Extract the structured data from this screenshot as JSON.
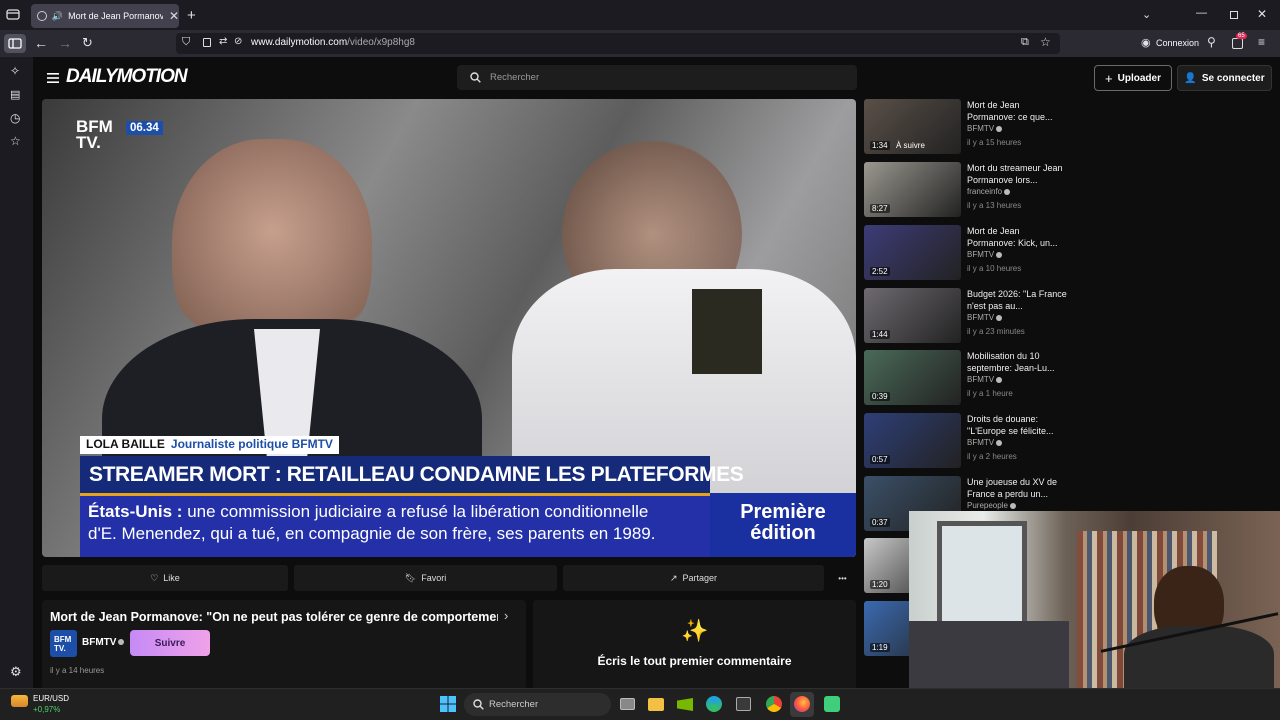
{
  "browser": {
    "tab_title": "Mort de Jean Pormanove: \"",
    "url_host": "www.dailymotion.com",
    "url_path": "/video/x9p8hg8",
    "account_label": "Connexion",
    "extension_badge": "65"
  },
  "site": {
    "logo": "DAILYMOTION",
    "search_placeholder": "Rechercher",
    "upload_label": "Uploader",
    "login_label": "Se connecter"
  },
  "video": {
    "channel_logo_top": "BFM",
    "channel_logo_bottom": "TV.",
    "clock": "06.34",
    "speaker_name": "LOLA BAILLE",
    "speaker_role": "Journaliste politique BFMTV",
    "headline": "STREAMER MORT : RETAILLEAU CONDAMNE LES PLATEFORMES",
    "ticker_label": "États-Unis :",
    "ticker_line1": "une commission judiciaire a refusé la libération conditionnelle",
    "ticker_line2": "d'E. Menendez, qui a tué, en compagnie de son frère, ses parents en 1989.",
    "show_line1": "Première",
    "show_line2": "édition"
  },
  "actions": {
    "like": "Like",
    "favorite": "Favori",
    "share": "Partager",
    "more": "•••"
  },
  "info": {
    "title": "Mort de Jean Pormanove: \"On ne peut pas tolérer ce genre de comportement...",
    "channel": "BFMTV",
    "channel_logo_top": "BFM",
    "channel_logo_bottom": "TV.",
    "follow_label": "Suivre",
    "published": "il y a 14 heures"
  },
  "comments": {
    "empty_label": "Écris le tout premier commentaire"
  },
  "recommendations": [
    {
      "title": "Mort de Jean Pormanove: ce que...",
      "channel": "BFMTV",
      "verified": true,
      "time": "il y a 15 heures",
      "duration": "1:34",
      "badge": "À suivre",
      "color": "#5a5048"
    },
    {
      "title": "Mort du streameur Jean Pormanove lors...",
      "channel": "franceinfo",
      "verified": true,
      "time": "il y a 13 heures",
      "duration": "8:27",
      "badge": "",
      "color": "#9a9890"
    },
    {
      "title": "Mort de Jean Pormanove: Kick, un...",
      "channel": "BFMTV",
      "verified": true,
      "time": "il y a 10 heures",
      "duration": "2:52",
      "badge": "",
      "color": "#3d3c78"
    },
    {
      "title": "Budget 2026: \"La France n'est pas au...",
      "channel": "BFMTV",
      "verified": true,
      "time": "il y a 23 minutes",
      "duration": "1:44",
      "badge": "",
      "color": "#6e6a70"
    },
    {
      "title": "Mobilisation du 10 septembre: Jean-Lu...",
      "channel": "BFMTV",
      "verified": true,
      "time": "il y a 1 heure",
      "duration": "0:39",
      "badge": "",
      "color": "#4a6a58"
    },
    {
      "title": "Droits de douane: \"L'Europe se félicite...",
      "channel": "BFMTV",
      "verified": true,
      "time": "il y a 2 heures",
      "duration": "0:57",
      "badge": "",
      "color": "#2e3f78"
    },
    {
      "title": "Une joueuse du XV de France a perdu un...",
      "channel": "Purepeople",
      "verified": true,
      "time": "",
      "duration": "0:37",
      "badge": "",
      "color": "#3a5068"
    },
    {
      "title": "",
      "channel": "",
      "verified": false,
      "time": "",
      "duration": "1:20",
      "badge": "",
      "color": "#c8c8c8"
    },
    {
      "title": "",
      "channel": "",
      "verified": false,
      "time": "",
      "duration": "1:19",
      "badge": "",
      "color": "#3a6ab0"
    }
  ],
  "taskbar": {
    "widget_label": "EUR/USD",
    "widget_value": "+0,97%",
    "search_label": "Rechercher"
  },
  "colors": {
    "follow_gradient_start": "#c58af6",
    "follow_gradient_end": "#f0a2e8",
    "ticker_bg": "#2430a8",
    "headline_bg": "#152a78",
    "bfm_blue": "#1d4fa8"
  }
}
